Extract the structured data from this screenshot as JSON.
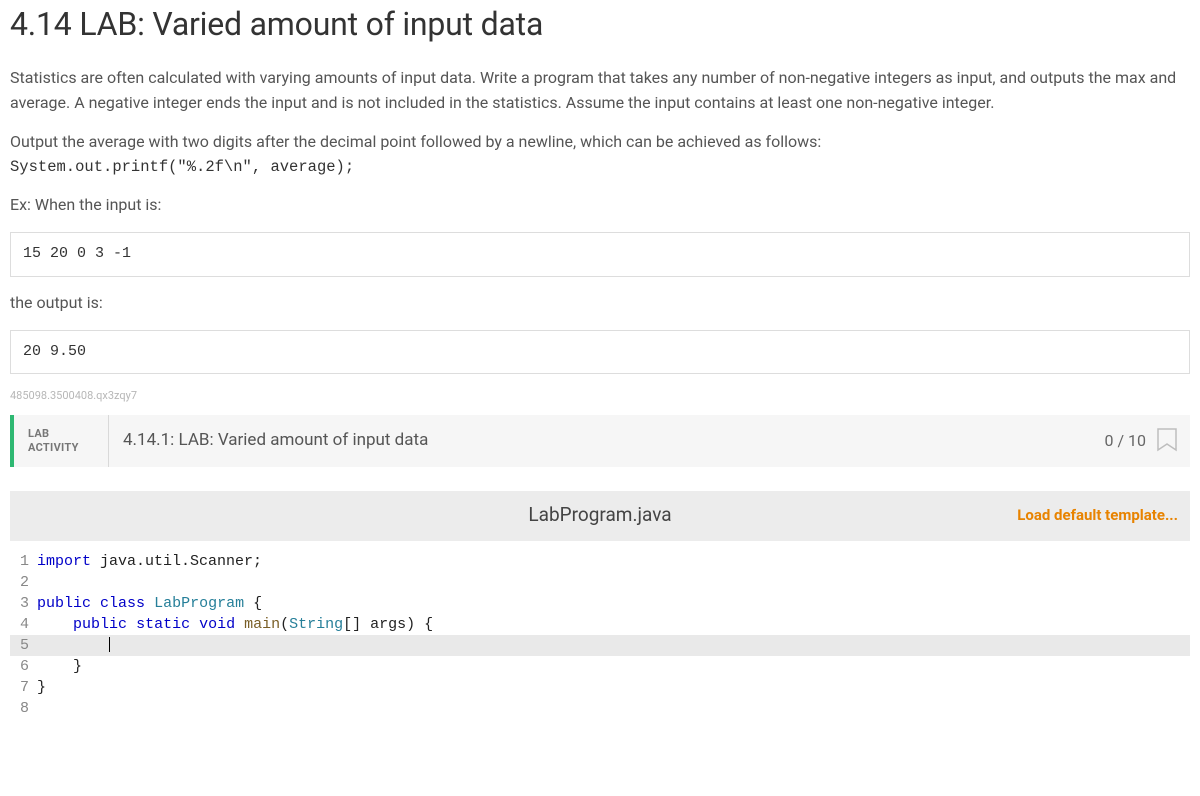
{
  "title": "4.14 LAB: Varied amount of input data",
  "p1": "Statistics are often calculated with varying amounts of input data. Write a program that takes any number of non-negative integers as input, and outputs the max and average. A negative integer ends the input and is not included in the statistics. Assume the input contains at least one non-negative integer.",
  "p2a": "Output the average with two digits after the decimal point followed by a newline, which can be achieved as follows:",
  "p2code": "System.out.printf(\"%.2f\\n\", average);",
  "p3": "Ex: When the input is:",
  "input_box": "15 20 0 3 -1",
  "p4": "the output is:",
  "output_box": "20 9.50",
  "watermark": "485098.3500408.qx3zqy7",
  "activity": {
    "type_line1": "LAB",
    "type_line2": "ACTIVITY",
    "title": "4.14.1: LAB: Varied amount of input data",
    "score": "0 / 10"
  },
  "editor": {
    "filename": "LabProgram.java",
    "load_template": "Load default template...",
    "lines": {
      "l1": "import java.util.Scanner;",
      "l3_kw1": "public",
      "l3_kw2": "class",
      "l3_cls": "LabProgram",
      "l4_kw1": "public",
      "l4_kw2": "static",
      "l4_kw3": "void",
      "l4_fn": "main",
      "l4_type": "String",
      "l4_rest": "[] args) {"
    },
    "gutter": [
      "1",
      "2",
      "3",
      "4",
      "5",
      "6",
      "7",
      "8"
    ]
  }
}
